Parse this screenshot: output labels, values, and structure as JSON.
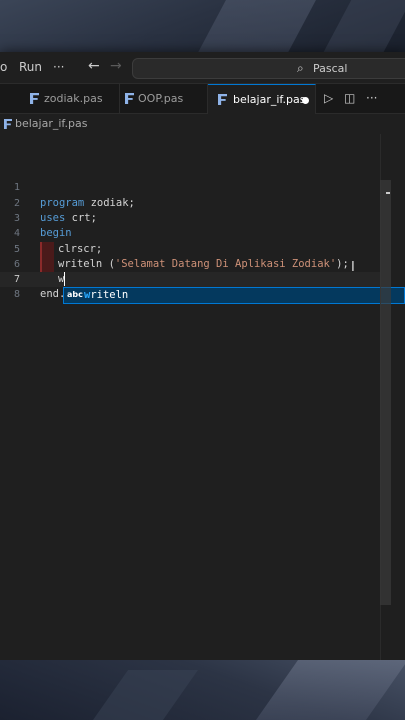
{
  "titlebar": {
    "menu_partial": "o",
    "menu_run": "Run",
    "menu_more": "···",
    "back_arrow": "←",
    "forward_arrow": "→",
    "search_icon": "⌕",
    "command_center_text": "Pascal"
  },
  "tabs": [
    {
      "label": "zodiak.pas",
      "active": false
    },
    {
      "label": "OOP.pas",
      "active": false
    },
    {
      "label": "belajar_if.pas",
      "active": true,
      "dirty": true
    }
  ],
  "toolbar": {
    "run_icon": "▷",
    "split_icon": "◫",
    "more_icon": "···"
  },
  "breadcrumb": {
    "file": "belajar_if.pas"
  },
  "editor": {
    "line_numbers": [
      "1",
      "2",
      "3",
      "4",
      "5",
      "6",
      "7",
      "8"
    ],
    "current_line": 7,
    "lines": {
      "l2_kw": "program",
      "l2_rest": " zodiak;",
      "l3_kw": "uses",
      "l3_rest": " crt;",
      "l4_kw": "begin",
      "l5_code": "clrscr;",
      "l6_id": "writeln (",
      "l6_str": "'Selamat Datang Di Aplikasi Zodiak'",
      "l6_end": ");",
      "l7_code": "w",
      "l8_code": "end."
    },
    "suggestion": {
      "kind_icon": "abc",
      "match": "w",
      "rest": "riteln"
    },
    "mouse_cursor": "I"
  },
  "colors": {
    "keyword": "#569cd6",
    "string": "#ce9178",
    "accent": "#0078d4",
    "editor_bg": "#1f1f1f"
  }
}
